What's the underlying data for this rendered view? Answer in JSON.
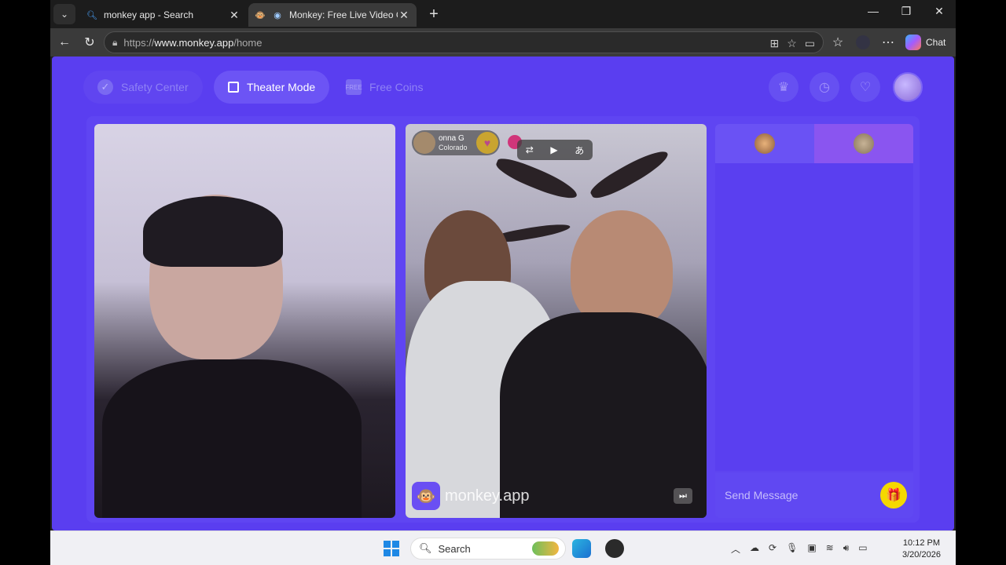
{
  "browser": {
    "tabs": [
      {
        "title": "monkey app - Search",
        "favicon": "search-icon",
        "active": false
      },
      {
        "title": "Monkey: Free Live Video Chat",
        "favicon": "monkey-icon",
        "active": true
      }
    ],
    "url_prefix": "https://",
    "url_host": "www.monkey.app",
    "url_path": "/home",
    "chat_label": "Chat"
  },
  "page": {
    "nav": {
      "safety_label": "Safety Center",
      "theater_label": "Theater Mode",
      "coins_label": "Free Coins"
    },
    "remote_user": {
      "name": "onna G",
      "location": "Colorado"
    },
    "watermark": "monkey.app",
    "chat": {
      "placeholder": "Send Message"
    }
  },
  "taskbar": {
    "search_label": "Search",
    "time": "10:12 PM",
    "date": "3/20/2026"
  },
  "colors": {
    "page_bg": "#5a3ef0",
    "accent": "#6c54f5",
    "gift": "#f5d800"
  }
}
